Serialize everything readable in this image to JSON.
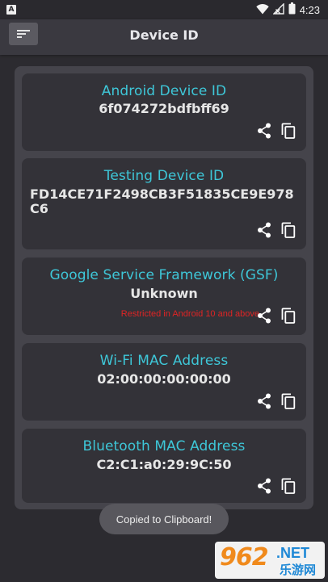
{
  "status_bar": {
    "notification_icon": "A",
    "time": "4:23",
    "icons": [
      "wifi-icon",
      "signal-icon",
      "battery-icon"
    ]
  },
  "app_bar": {
    "title": "Device ID",
    "menu_icon": "sort-icon"
  },
  "cards": [
    {
      "label": "Android Device ID",
      "value": "6f074272bdfbff69",
      "note": ""
    },
    {
      "label": "Testing Device ID",
      "value": "FD14CE71F2498CB3F51835CE9E978C6",
      "note": ""
    },
    {
      "label": "Google Service Framework (GSF)",
      "value": "Unknown",
      "note": "Restricted in Android 10 and above"
    },
    {
      "label": "Wi-Fi MAC Address",
      "value": "02:00:00:00:00:00",
      "note": ""
    },
    {
      "label": "Bluetooth MAC Address",
      "value": "C2:C1:a0:29:9C:50",
      "note": ""
    }
  ],
  "toast": {
    "text": "Copied to Clipboard!"
  },
  "watermark": {
    "logo": "962",
    "suffix": ".NET",
    "sub": "乐游网"
  },
  "colors": {
    "accent": "#3ec7d8",
    "warning": "#e02424",
    "background": "#2c2b30",
    "card": "#333238",
    "panel": "#45444b"
  }
}
